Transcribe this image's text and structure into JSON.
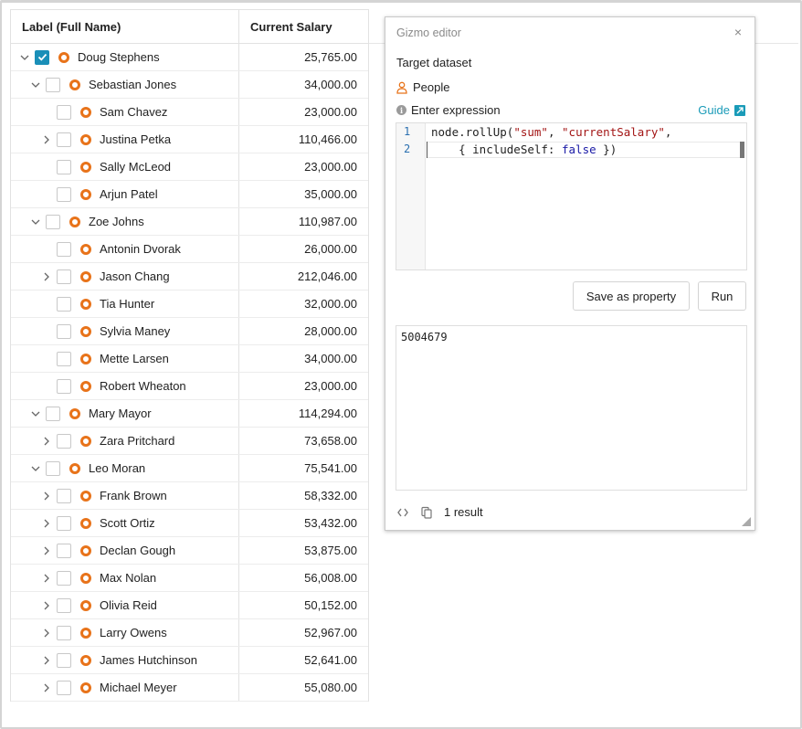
{
  "grid": {
    "headers": {
      "label": "Label (Full Name)",
      "salary": "Current Salary"
    },
    "rows": [
      {
        "name": "Doug Stephens",
        "salary": "25,765.00",
        "level": 0,
        "chevron": "down",
        "checked": true
      },
      {
        "name": "Sebastian Jones",
        "salary": "34,000.00",
        "level": 1,
        "chevron": "down",
        "checked": false
      },
      {
        "name": "Sam Chavez",
        "salary": "23,000.00",
        "level": 2,
        "chevron": "none",
        "checked": false
      },
      {
        "name": "Justina Petka",
        "salary": "110,466.00",
        "level": 2,
        "chevron": "right",
        "checked": false
      },
      {
        "name": "Sally McLeod",
        "salary": "23,000.00",
        "level": 2,
        "chevron": "none",
        "checked": false
      },
      {
        "name": "Arjun Patel",
        "salary": "35,000.00",
        "level": 2,
        "chevron": "none",
        "checked": false
      },
      {
        "name": "Zoe Johns",
        "salary": "110,987.00",
        "level": 1,
        "chevron": "down",
        "checked": false
      },
      {
        "name": "Antonin Dvorak",
        "salary": "26,000.00",
        "level": 2,
        "chevron": "none",
        "checked": false
      },
      {
        "name": "Jason Chang",
        "salary": "212,046.00",
        "level": 2,
        "chevron": "right",
        "checked": false
      },
      {
        "name": "Tia Hunter",
        "salary": "32,000.00",
        "level": 2,
        "chevron": "none",
        "checked": false
      },
      {
        "name": "Sylvia Maney",
        "salary": "28,000.00",
        "level": 2,
        "chevron": "none",
        "checked": false
      },
      {
        "name": "Mette Larsen",
        "salary": "34,000.00",
        "level": 2,
        "chevron": "none",
        "checked": false
      },
      {
        "name": "Robert Wheaton",
        "salary": "23,000.00",
        "level": 2,
        "chevron": "none",
        "checked": false
      },
      {
        "name": "Mary Mayor",
        "salary": "114,294.00",
        "level": 1,
        "chevron": "down",
        "checked": false
      },
      {
        "name": "Zara Pritchard",
        "salary": "73,658.00",
        "level": 2,
        "chevron": "right",
        "checked": false
      },
      {
        "name": "Leo Moran",
        "salary": "75,541.00",
        "level": 1,
        "chevron": "down",
        "checked": false
      },
      {
        "name": "Frank Brown",
        "salary": "58,332.00",
        "level": 2,
        "chevron": "right",
        "checked": false
      },
      {
        "name": "Scott Ortiz",
        "salary": "53,432.00",
        "level": 2,
        "chevron": "right",
        "checked": false
      },
      {
        "name": "Declan Gough",
        "salary": "53,875.00",
        "level": 2,
        "chevron": "right",
        "checked": false
      },
      {
        "name": "Max Nolan",
        "salary": "56,008.00",
        "level": 2,
        "chevron": "right",
        "checked": false
      },
      {
        "name": "Olivia Reid",
        "salary": "50,152.00",
        "level": 2,
        "chevron": "right",
        "checked": false
      },
      {
        "name": "Larry Owens",
        "salary": "52,967.00",
        "level": 2,
        "chevron": "right",
        "checked": false
      },
      {
        "name": "James Hutchinson",
        "salary": "52,641.00",
        "level": 2,
        "chevron": "right",
        "checked": false
      },
      {
        "name": "Michael Meyer",
        "salary": "55,080.00",
        "level": 2,
        "chevron": "right",
        "checked": false
      }
    ]
  },
  "gizmo": {
    "title": "Gizmo editor",
    "close": "×",
    "target_label": "Target dataset",
    "dataset": "People",
    "expression_label": "Enter expression",
    "guide": "Guide",
    "code": {
      "line_numbers": [
        "1",
        "2"
      ],
      "line1": {
        "p1": "node.rollUp(",
        "s1": "\"sum\"",
        "p2": ", ",
        "s2": "\"currentSalary\"",
        "p3": ","
      },
      "line2": {
        "p1": "    { includeSelf: ",
        "kw": "false",
        "p2": " })"
      }
    },
    "save_button": "Save as property",
    "run_button": "Run",
    "result": "5004679",
    "result_count": "1 result"
  },
  "colors": {
    "accent": "#1a8fb8",
    "node_ring": "#e8731a",
    "link": "#1a9bb8"
  }
}
